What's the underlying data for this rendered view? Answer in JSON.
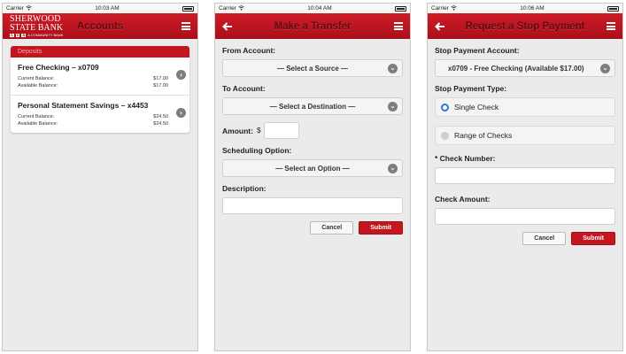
{
  "status": {
    "carrier": "Carrier",
    "t1": "10:03 AM",
    "t2": "10:04 AM",
    "t3": "10:06 AM"
  },
  "accounts": {
    "logo_l1": "SHERWOOD",
    "logo_l2": "STATE BANK",
    "logo_l3": [
      "S",
      "S",
      "B"
    ],
    "logo_tag": "A COMMUNITY BANK",
    "title": "Accounts",
    "section": "Deposits",
    "items": [
      {
        "name": "Free Checking – x0709",
        "current_label": "Current Balance:",
        "current": "$17.00",
        "available_label": "Available Balance:",
        "available": "$17.00"
      },
      {
        "name": "Personal Statement Savings – x4453",
        "current_label": "Current Balance:",
        "current": "$24.50",
        "available_label": "Available Balance:",
        "available": "$24.50"
      }
    ]
  },
  "transfer": {
    "title": "Make a Transfer",
    "from_label": "From Account:",
    "from_value": "— Select a Source —",
    "to_label": "To Account:",
    "to_value": "— Select a Destination —",
    "amount_label": "Amount:",
    "currency": "$",
    "sched_label": "Scheduling Option:",
    "sched_value": "— Select an Option —",
    "desc_label": "Description:",
    "cancel": "Cancel",
    "submit": "Submit"
  },
  "stop": {
    "title": "Request a Stop Payment",
    "acct_label": "Stop Payment Account:",
    "acct_value": "x0709 - Free Checking (Available $17.00)",
    "type_label": "Stop Payment Type:",
    "opt_single": "Single Check",
    "opt_range": "Range of Checks",
    "check_label": "* Check Number:",
    "amount_label": "Check Amount:",
    "cancel": "Cancel",
    "submit": "Submit"
  },
  "colors": {
    "brand": "#c4161f",
    "radio_on": "#2b78d6"
  }
}
